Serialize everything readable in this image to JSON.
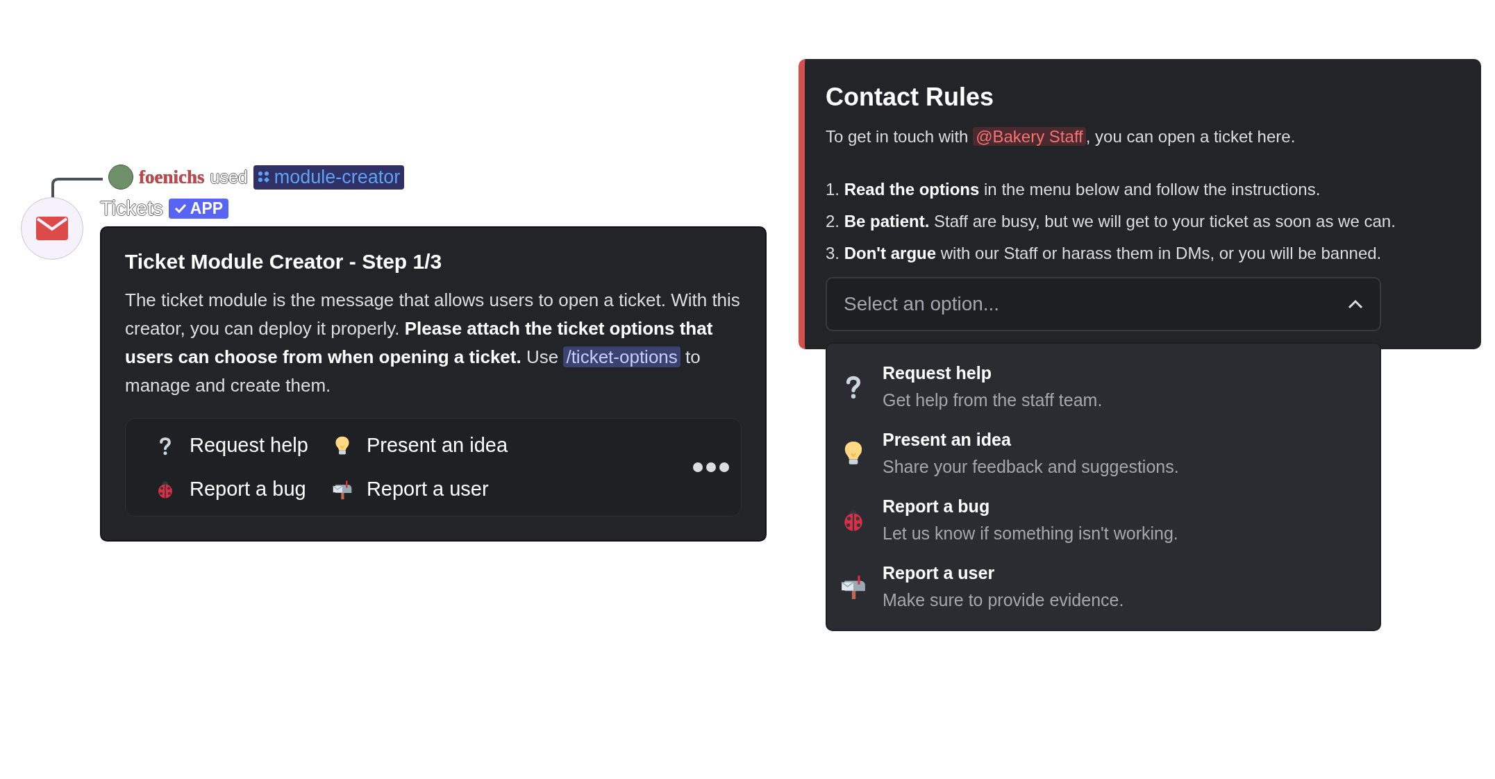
{
  "reply": {
    "username": "foenichs",
    "action": "used",
    "command": "module-creator"
  },
  "author": {
    "name": "Tickets",
    "badge": "APP",
    "verified": true
  },
  "module_embed": {
    "title": "Ticket Module Creator - Step 1/3",
    "description": "The ticket module is the message that allows users to open a ticket. With this creator, you can deploy it properly. **Please attach the ticket options that users can choose from when opening a ticket.** Use",
    "command_mention": "/ticket-options",
    "description_end": "to manage and create them.",
    "options": [
      {
        "kind": "question",
        "label": "Request help"
      },
      {
        "kind": "bulb",
        "label": "Present an idea"
      },
      {
        "kind": "bug",
        "label": "Report a bug"
      },
      {
        "kind": "mailbox",
        "label": "Report a user"
      }
    ]
  },
  "contact_rules": {
    "title": "Contact Rules",
    "intro_before": "To get in touch with",
    "role_mention": "@Bakery Staff",
    "intro_after": ", you can open a ticket here.",
    "rules": [
      "1. **Read the options** in the menu below and follow the instructions.",
      "2. **Be patient.** Staff are busy, but we will get to your ticket as soon as we can.",
      "3. **Don't argue** with our Staff or harass them in DMs, or you will be banned."
    ],
    "select": {
      "placeholder": "Select an option...",
      "expanded": true
    },
    "options": [
      {
        "kind": "question",
        "label": "Request help",
        "description": "Get help from the staff team."
      },
      {
        "kind": "bulb",
        "label": "Present an idea",
        "description": "Share your feedback and suggestions."
      },
      {
        "kind": "bug",
        "label": "Report a bug",
        "description": "Let us know if something isn't working."
      },
      {
        "kind": "mailbox",
        "label": "Report a user",
        "description": "Make sure to provide evidence."
      }
    ]
  }
}
